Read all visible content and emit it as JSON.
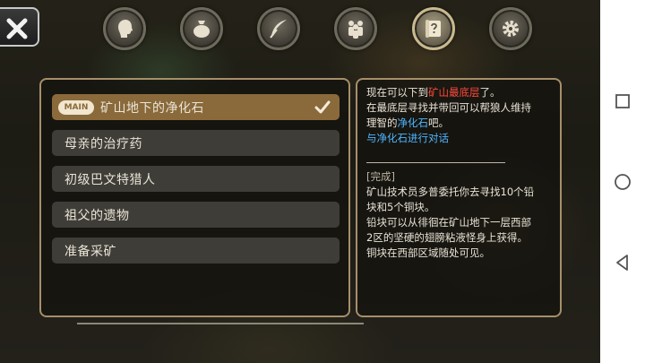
{
  "tabs": [
    {
      "icon": "character-head-icon",
      "active": false
    },
    {
      "icon": "inventory-bag-icon",
      "active": false
    },
    {
      "icon": "skills-feather-icon",
      "active": false
    },
    {
      "icon": "party-members-icon",
      "active": false
    },
    {
      "icon": "quest-scroll-icon",
      "active": true
    },
    {
      "icon": "settings-gear-icon",
      "active": false
    }
  ],
  "quest_list": {
    "main_badge": "MAIN",
    "items": [
      {
        "label": "矿山地下的净化石",
        "selected": true
      },
      {
        "label": "母亲的治疗药",
        "selected": false
      },
      {
        "label": "初级巴文特猎人",
        "selected": false
      },
      {
        "label": "祖父的遗物",
        "selected": false
      },
      {
        "label": "准备采矿",
        "selected": false
      }
    ]
  },
  "quest_detail": {
    "line1_a": "现在可以下到",
    "line1_hl": "矿山最底层",
    "line1_b": "了。",
    "line2": "在最底层寻找并带回可以帮狼人维持",
    "line3_a": "理智的",
    "line3_hl": "净化石",
    "line3_b": "吧。",
    "objective": "与净化石进行对话",
    "status": "[完成]",
    "done1": "矿山技术员多普委托你去寻找10个铅",
    "done2": "块和5个铜块。",
    "done3": "铅块可以从徘徊在矿山地下一层西部",
    "done4": "2区的坚硬的翅膀粘液怪身上获得。",
    "done5": "铜块在西部区域随处可见。"
  },
  "colors": {
    "highlight_red": "#ff4a3d",
    "highlight_blue": "#4fb6ff",
    "selected_item": "#8a6a3b",
    "panel_border": "#a68f6a"
  }
}
